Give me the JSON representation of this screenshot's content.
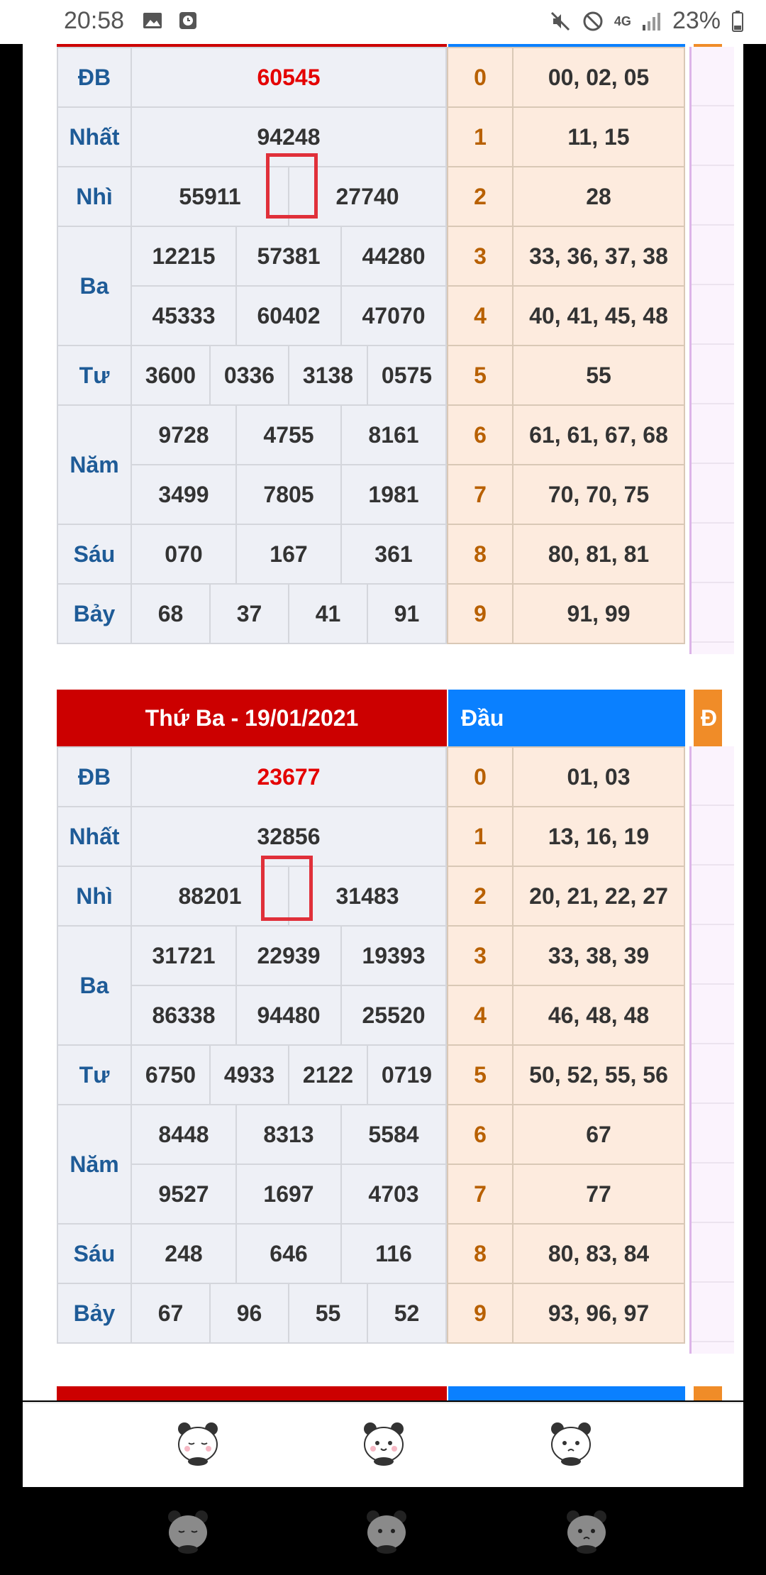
{
  "status": {
    "time": "20:58",
    "battery": "23%",
    "network": "4G"
  },
  "draw1": {
    "db": "60545",
    "nhat": "94248",
    "nhi": [
      "55911",
      "27740"
    ],
    "ba": [
      "12215",
      "57381",
      "44280",
      "45333",
      "60402",
      "47070"
    ],
    "tu": [
      "3600",
      "0336",
      "3138",
      "0575"
    ],
    "nam": [
      "9728",
      "4755",
      "8161",
      "3499",
      "7805",
      "1981"
    ],
    "sau": [
      "070",
      "167",
      "361"
    ],
    "bay": [
      "68",
      "37",
      "41",
      "91"
    ],
    "dau": [
      "00, 02, 05",
      "11, 15",
      "28",
      "33, 36, 37, 38",
      "40, 41, 45, 48",
      "55",
      "61, 61, 67, 68",
      "70, 70, 75",
      "80, 81, 81",
      "91, 99"
    ]
  },
  "draw2": {
    "title": "Thứ Ba - 19/01/2021",
    "dau_header": "Đầu",
    "third_header": "Đ",
    "db": "23677",
    "nhat": "32856",
    "nhi": [
      "88201",
      "31483"
    ],
    "ba": [
      "31721",
      "22939",
      "19393",
      "86338",
      "94480",
      "25520"
    ],
    "tu": [
      "6750",
      "4933",
      "2122",
      "0719"
    ],
    "nam": [
      "8448",
      "8313",
      "5584",
      "9527",
      "1697",
      "4703"
    ],
    "sau": [
      "248",
      "646",
      "116"
    ],
    "bay": [
      "67",
      "96",
      "55",
      "52"
    ],
    "dau": [
      "01, 03",
      "13, 16, 19",
      "20, 21, 22, 27",
      "33, 38, 39",
      "46, 48, 48",
      "50, 52, 55, 56",
      "67",
      "77",
      "80, 83, 84",
      "93, 96, 97"
    ]
  },
  "labels": {
    "db": "ĐB",
    "nhat": "Nhất",
    "nhi": "Nhì",
    "ba": "Ba",
    "tu": "Tư",
    "nam": "Năm",
    "sau": "Sáu",
    "bay": "Bảy"
  },
  "digits": [
    "0",
    "1",
    "2",
    "3",
    "4",
    "5",
    "6",
    "7",
    "8",
    "9"
  ],
  "tabs": [
    {
      "icon": "panda-sleepy-icon"
    },
    {
      "icon": "panda-happy-icon"
    },
    {
      "icon": "panda-sad-icon"
    }
  ],
  "colors": {
    "red": "#cc0000",
    "blue": "#0a80ff",
    "orange": "#f08c28",
    "label": "#1e5b97",
    "db_number": "#e40000",
    "digit": "#b86000"
  }
}
